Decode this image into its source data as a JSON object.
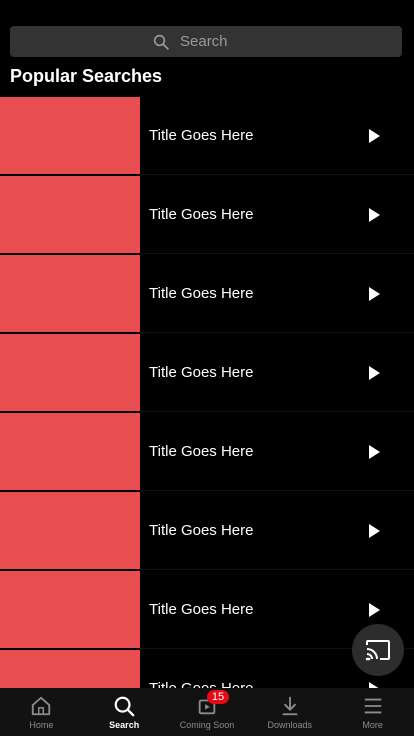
{
  "search": {
    "placeholder": "Search"
  },
  "section": {
    "title": "Popular Searches"
  },
  "items": [
    {
      "title": "Title Goes Here"
    },
    {
      "title": "Title Goes Here"
    },
    {
      "title": "Title Goes Here"
    },
    {
      "title": "Title Goes Here"
    },
    {
      "title": "Title Goes Here"
    },
    {
      "title": "Title Goes Here"
    },
    {
      "title": "Title Goes Here"
    },
    {
      "title": "Title Goes Here"
    }
  ],
  "tabs": [
    {
      "label": "Home",
      "icon": "home-icon"
    },
    {
      "label": "Search",
      "icon": "search-icon",
      "active": true
    },
    {
      "label": "Coming Soon",
      "icon": "coming-soon-icon",
      "badge": "15"
    },
    {
      "label": "Downloads",
      "icon": "download-icon"
    },
    {
      "label": "More",
      "icon": "menu-icon"
    }
  ],
  "colors": {
    "thumbnail": "#e84e50",
    "badge": "#e50914",
    "background": "#000000"
  },
  "cast": {
    "icon": "cast-icon"
  }
}
